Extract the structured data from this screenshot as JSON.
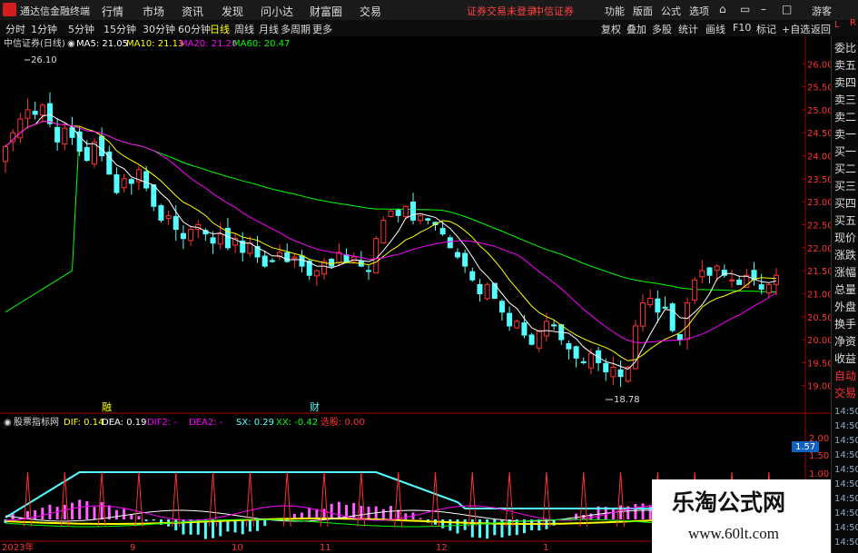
{
  "titlebar": {
    "app_name": "通达信金融终端",
    "menus": [
      "行情",
      "市场",
      "资讯",
      "发现",
      "问小达",
      "财富圈",
      "交易"
    ],
    "status": [
      "证券交易未登录",
      "中信证券"
    ],
    "tools": [
      "功能",
      "版面",
      "公式",
      "选项"
    ],
    "guest": "游客"
  },
  "toolbar": {
    "periods": [
      "分时",
      "1分钟",
      "5分钟",
      "15分钟",
      "30分钟",
      "60分钟",
      "日线",
      "周线",
      "月线",
      "多周期",
      "更多"
    ],
    "active_period": "日线",
    "right_buttons": [
      "复权",
      "叠加",
      "多股",
      "统计",
      "画线",
      "F10",
      "标记",
      "+自选",
      "返回"
    ]
  },
  "chart": {
    "header": "中信证券(日线)",
    "ma5": "MA5: 21.05",
    "ma10": "MA10: 21.13",
    "ma20": "MA20: 21.20",
    "ma60": "MA60: 20.47",
    "high_label": "26.10",
    "low_label": "18.78",
    "y_ticks": [
      "26.00",
      "25.50",
      "25.00",
      "24.50",
      "24.00",
      "23.50",
      "23.00",
      "22.50",
      "22.00",
      "21.50",
      "21.00",
      "20.50",
      "20.00",
      "19.50",
      "19.00"
    ],
    "markers": [
      "融",
      "财"
    ],
    "colors": {
      "up": "#ff3232",
      "down": "#54ffff",
      "ma5": "#ffffff",
      "ma10": "#ffff00",
      "ma20": "#ff00ff",
      "ma60": "#00ff00"
    }
  },
  "chart_data": {
    "type": "candlestick",
    "title": "中信证券(日线)",
    "ylim": [
      18.6,
      26.4
    ],
    "high": 26.1,
    "low": 18.78,
    "ma_latest": {
      "MA5": 21.05,
      "MA10": 21.13,
      "MA20": 21.2,
      "MA60": 20.47
    },
    "series_close": [
      24.2,
      24.5,
      24.8,
      25.0,
      24.9,
      25.1,
      24.7,
      24.3,
      24.6,
      24.4,
      24.1,
      23.9,
      24.3,
      24.0,
      23.6,
      23.2,
      23.5,
      23.4,
      23.7,
      23.3,
      22.9,
      22.6,
      22.7,
      22.4,
      22.2,
      22.4,
      22.5,
      22.3,
      22.1,
      22.3,
      22.0,
      22.2,
      21.9,
      22.1,
      21.8,
      21.6,
      21.7,
      21.9,
      21.7,
      21.8,
      21.6,
      21.4,
      21.5,
      21.7,
      21.6,
      21.9,
      21.7,
      21.8,
      21.6,
      21.5,
      22.2,
      22.6,
      22.8,
      22.7,
      22.9,
      22.6,
      22.7,
      22.6,
      22.5,
      22.3,
      22.0,
      21.8,
      21.6,
      21.3,
      21.0,
      21.2,
      20.9,
      20.6,
      20.3,
      20.4,
      20.1,
      19.9,
      20.2,
      20.4,
      20.3,
      20.0,
      19.8,
      19.6,
      19.5,
      19.7,
      19.5,
      19.3,
      19.4,
      19.2,
      19.4,
      20.3,
      20.8,
      20.9,
      20.6,
      20.7,
      20.2,
      20.0,
      20.8,
      21.3,
      21.5,
      21.4,
      21.6,
      21.4,
      21.3,
      21.2,
      21.4,
      21.3,
      21.1,
      21.2,
      21.4
    ],
    "indicator": {
      "name": "股票指标网",
      "DIF": "DIF: 0.14",
      "DEA": "DEA: 0.19",
      "DIF2": "DIF2: -",
      "DEA2": "DEA2: -",
      "SX": "SX: 0.29",
      "XX": "XX: -0.42",
      "select": "选股: 0.00",
      "y_ticks": [
        "2.00",
        "1.50",
        "1.00"
      ],
      "current": "1.57"
    },
    "x_labels": [
      "2023年",
      "9",
      "10",
      "11",
      "12",
      "1"
    ]
  },
  "right_panel": {
    "top_labels": [
      "L",
      "R"
    ],
    "items": [
      "委比",
      "卖五",
      "卖四",
      "卖三",
      "卖二",
      "卖一",
      "买一",
      "买二",
      "买三",
      "买四",
      "买五",
      "现价",
      "涨跌",
      "涨幅",
      "总量",
      "外盘",
      "换手",
      "净资",
      "收益",
      "自动",
      "交易"
    ],
    "times": [
      "14:50",
      "14:50",
      "14:50",
      "14:50",
      "14:50",
      "14:50",
      "14:50",
      "14:50",
      "14:50",
      "14:50"
    ]
  },
  "watermark": {
    "title": "乐淘公式网",
    "url": "www.60lt.com"
  }
}
